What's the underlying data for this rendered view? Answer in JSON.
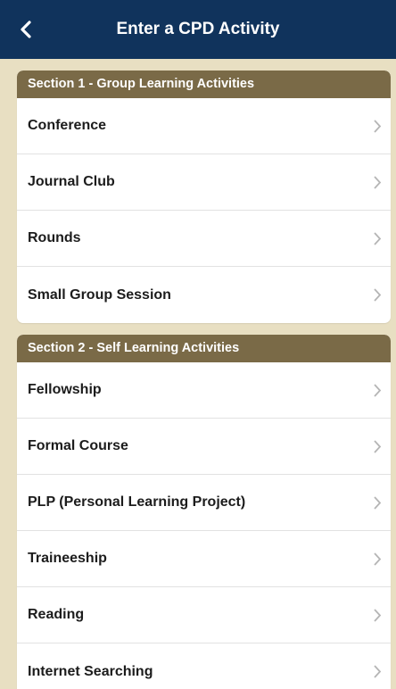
{
  "navbar": {
    "title": "Enter a CPD Activity",
    "back_icon": "chevron-left-icon"
  },
  "colors": {
    "navbar": "#10335c",
    "section_header": "#7a6a47",
    "background": "#e8dfc2"
  },
  "sections": [
    {
      "header": "Section 1 - Group Learning Activities",
      "items": [
        {
          "label": "Conference"
        },
        {
          "label": "Journal Club"
        },
        {
          "label": "Rounds"
        },
        {
          "label": "Small Group Session"
        }
      ]
    },
    {
      "header": "Section 2 - Self Learning Activities",
      "items": [
        {
          "label": "Fellowship"
        },
        {
          "label": "Formal Course"
        },
        {
          "label": "PLP (Personal Learning Project)"
        },
        {
          "label": "Traineeship"
        },
        {
          "label": "Reading"
        },
        {
          "label": "Internet Searching"
        }
      ]
    }
  ]
}
